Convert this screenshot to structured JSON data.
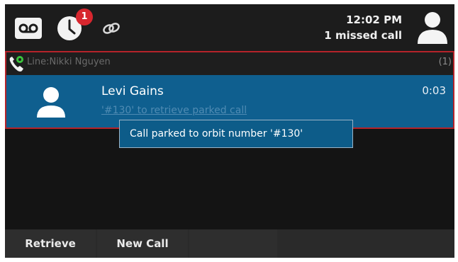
{
  "status_bar": {
    "voicemail_icon": "voicemail-icon",
    "history_icon": "history-icon",
    "history_badge": "1",
    "link_icon": "link-icon",
    "time": "12:02 PM",
    "missed_calls": "1 missed call",
    "user_icon": "user-icon"
  },
  "line": {
    "label": "Line:Nikki Nguyen",
    "count": "(1)"
  },
  "call": {
    "name": "Levi Gains",
    "subtext": "'#130' to retrieve parked call",
    "timer": "0:03"
  },
  "toast": {
    "message": "Call parked to orbit number '#130'"
  },
  "softkeys": {
    "retrieve": "Retrieve",
    "new_call": "New Call"
  },
  "colors": {
    "badge": "#d7262e",
    "highlight": "#0f5f8f",
    "border": "#b5232a",
    "presence": "#3cc43c"
  }
}
